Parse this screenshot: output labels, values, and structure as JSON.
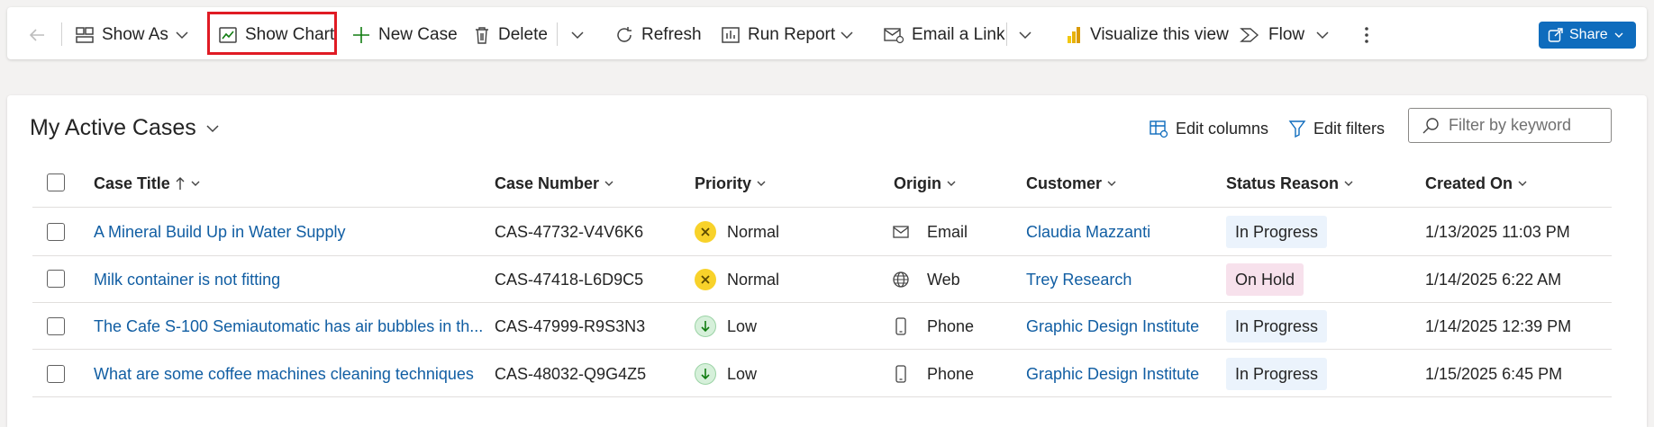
{
  "commandbar": {
    "show_as": "Show As",
    "show_chart": "Show Chart",
    "new_case": "New Case",
    "delete": "Delete",
    "refresh": "Refresh",
    "run_report": "Run Report",
    "email_link": "Email a Link",
    "visualize": "Visualize this view",
    "flow": "Flow",
    "share": "Share"
  },
  "view": {
    "title": "My Active Cases",
    "edit_columns": "Edit columns",
    "edit_filters": "Edit filters",
    "filter_placeholder": "Filter by keyword"
  },
  "columns": {
    "case_title": "Case Title",
    "case_number": "Case Number",
    "priority": "Priority",
    "origin": "Origin",
    "customer": "Customer",
    "status_reason": "Status Reason",
    "created_on": "Created On"
  },
  "rows": [
    {
      "title": "A Mineral Build Up in Water Supply",
      "number": "CAS-47732-V4V6K6",
      "priority": "Normal",
      "origin": "Email",
      "customer": "Claudia Mazzanti",
      "status": "In Progress",
      "created": "1/13/2025 11:03 PM"
    },
    {
      "title": "Milk container is not fitting",
      "number": "CAS-47418-L6D9C5",
      "priority": "Normal",
      "origin": "Web",
      "customer": "Trey Research",
      "status": "On Hold",
      "created": "1/14/2025 6:22 AM"
    },
    {
      "title": "The Cafe S-100 Semiautomatic has air bubbles in th...",
      "number": "CAS-47999-R9S3N3",
      "priority": "Low",
      "origin": "Phone",
      "customer": "Graphic Design Institute",
      "status": "In Progress",
      "created": "1/14/2025 12:39 PM"
    },
    {
      "title": "What are some coffee machines cleaning techniques",
      "number": "CAS-48032-Q9G4Z5",
      "priority": "Low",
      "origin": "Phone",
      "customer": "Graphic Design Institute",
      "status": "In Progress",
      "created": "1/15/2025 6:45 PM"
    }
  ],
  "colors": {
    "accent": "#0f6cbd",
    "link": "#115ea3",
    "highlight": "#e01b24",
    "in_progress_bg": "#ebf3fc",
    "on_hold_bg": "#f7e1ec",
    "normal_priority": "#f8d22a",
    "low_priority": "#d6f0da"
  }
}
